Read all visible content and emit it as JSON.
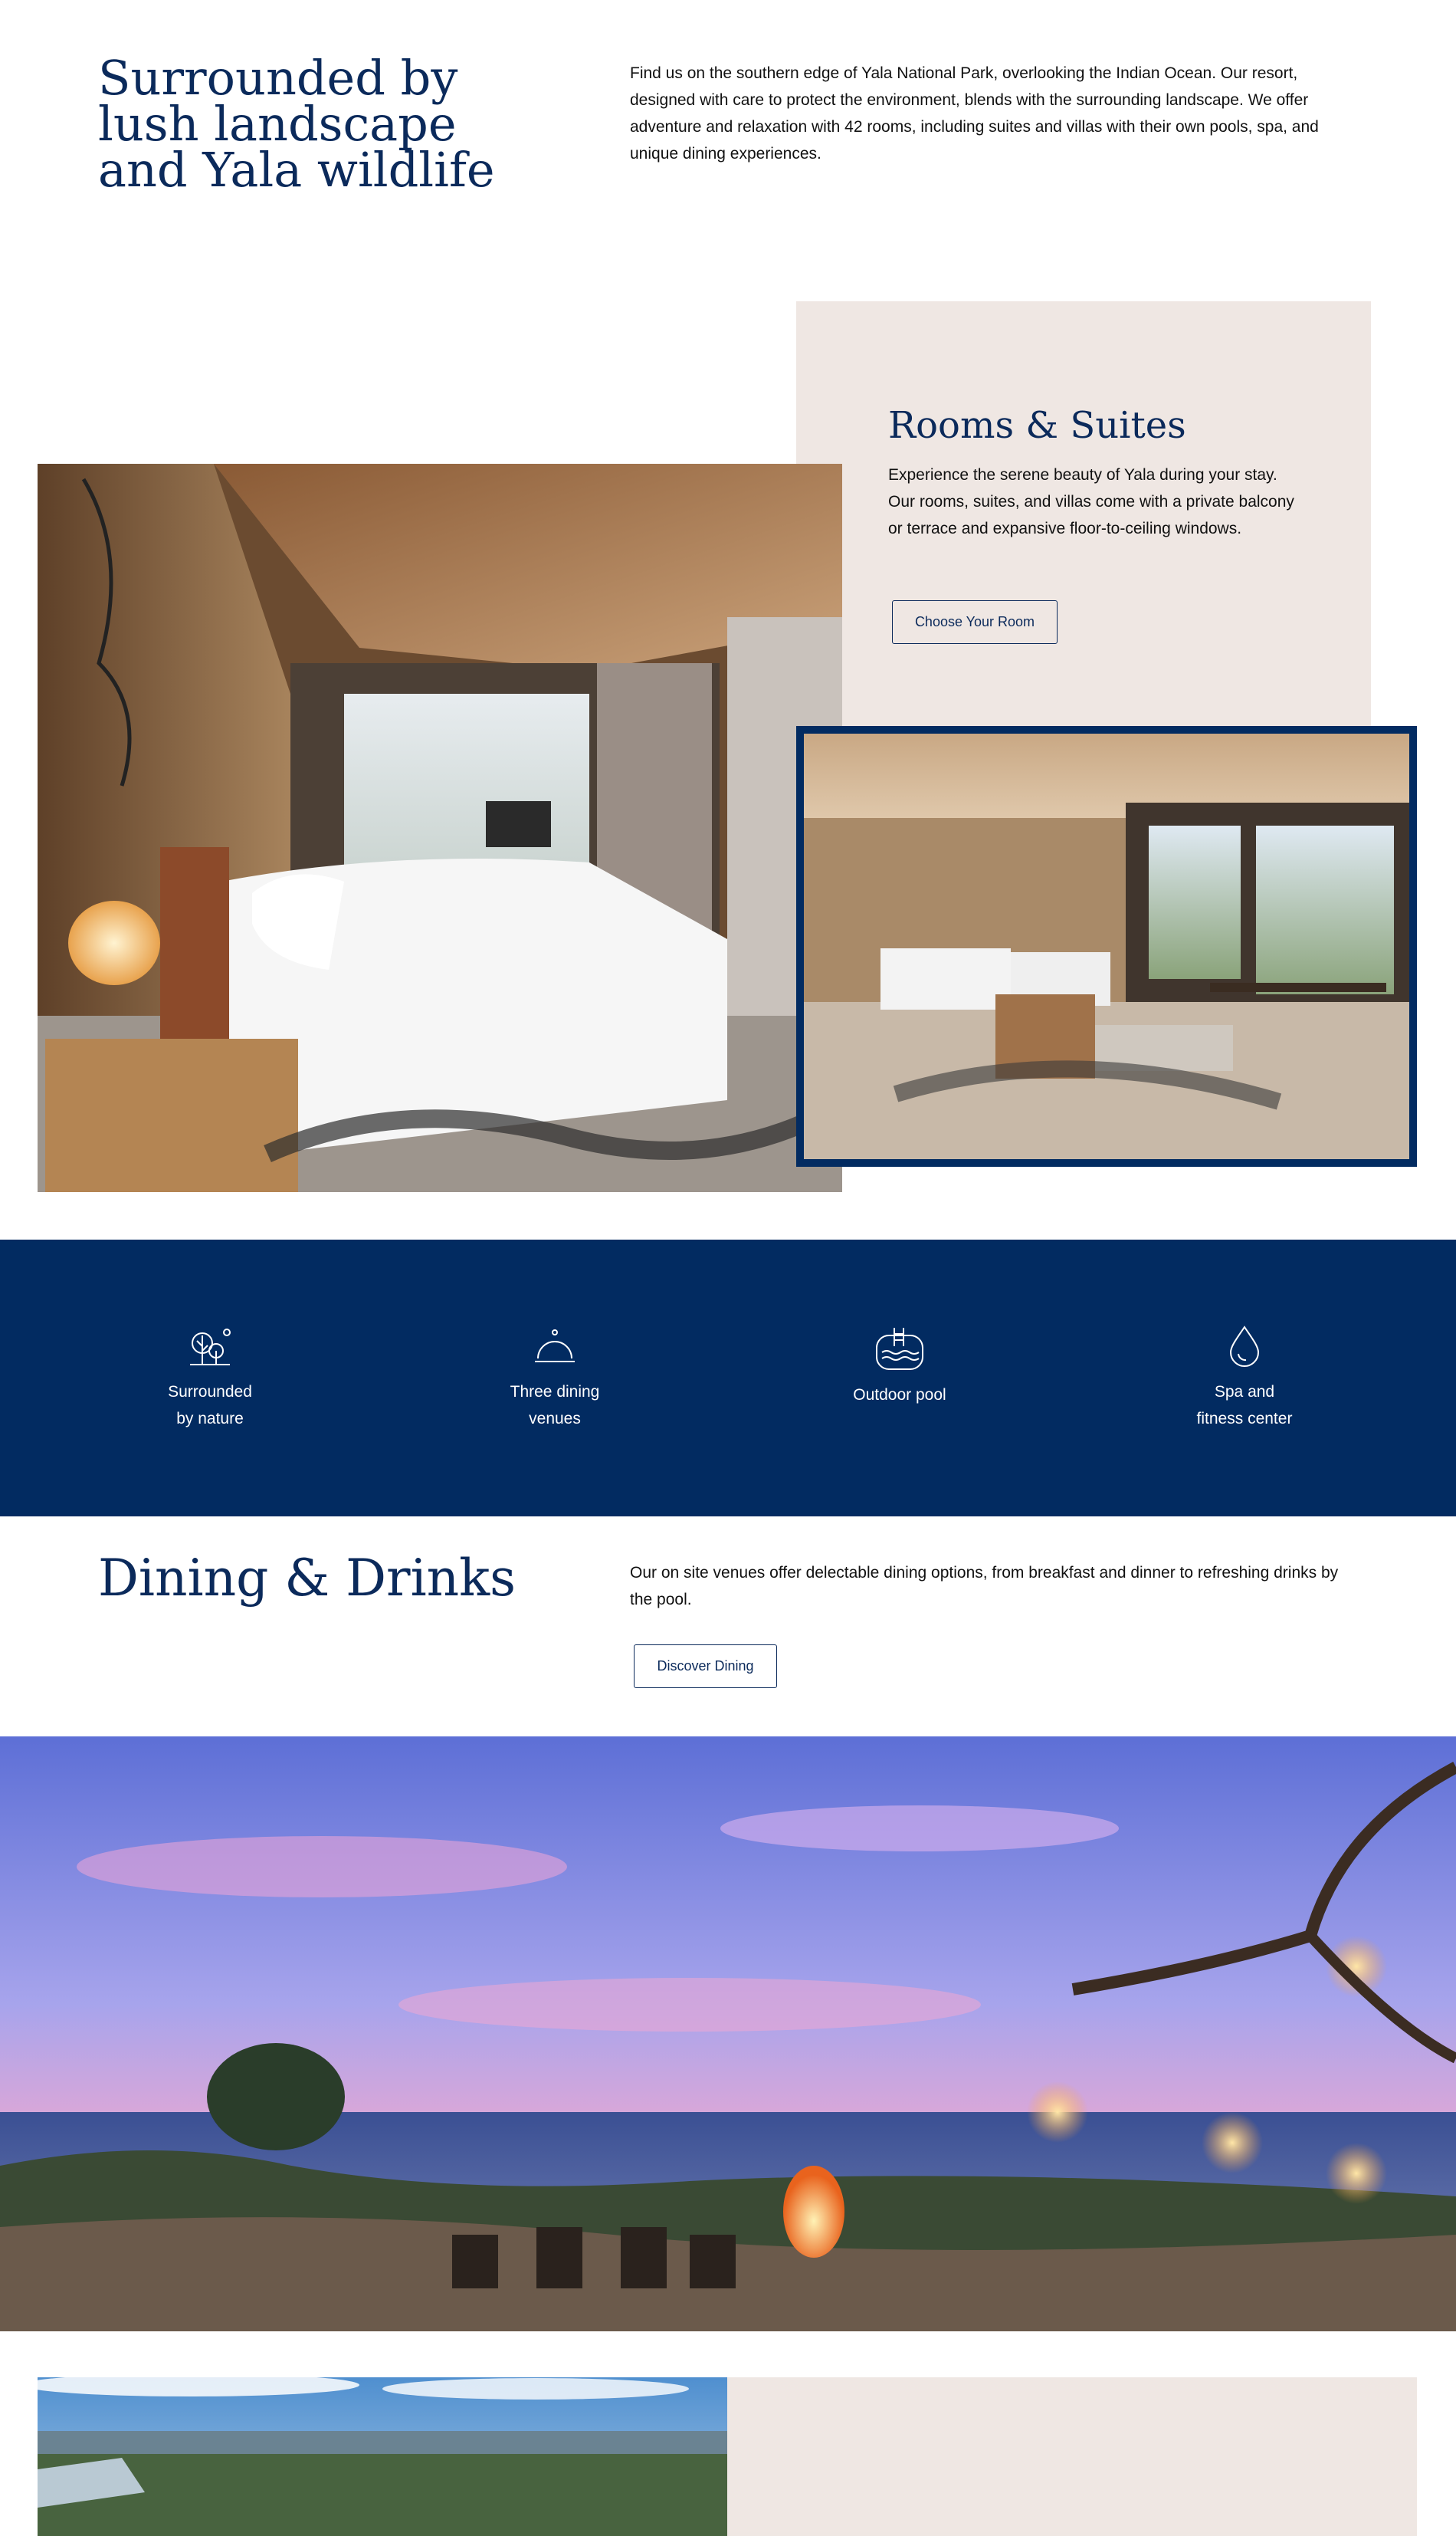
{
  "intro": {
    "title": "Surrounded by lush landscape and Yala wildlife",
    "text": "Find us on the southern edge of Yala National Park, overlooking the Indian Ocean. Our resort, designed with care to protect the environment, blends with the surrounding landscape. We offer adventure and relaxation with 42 rooms, including suites and villas with their own pools, spa, and unique dining experiences."
  },
  "rooms": {
    "title": "Rooms & Suites",
    "text": "Experience the serene beauty of Yala during your stay. Our rooms, suites, and villas come with a private balcony or terrace and expansive floor-to-ceiling windows.",
    "button": "Choose Your Room"
  },
  "amenities": [
    {
      "label": "Surrounded\nby nature",
      "icon": "trees-icon"
    },
    {
      "label": "Three dining\nvenues",
      "icon": "cloche-icon"
    },
    {
      "label": "Outdoor pool",
      "icon": "pool-icon"
    },
    {
      "label": "Spa and\nfitness center",
      "icon": "water-drop-icon"
    }
  ],
  "dining": {
    "title": "Dining & Drinks",
    "text": "Our on site venues offer delectable dining options, from breakfast and dinner to refreshing drinks by the pool.",
    "button": "Discover Dining"
  },
  "colors": {
    "navy": "#022b61",
    "beige": "#efe7e3",
    "heading": "#0b2a5b"
  }
}
